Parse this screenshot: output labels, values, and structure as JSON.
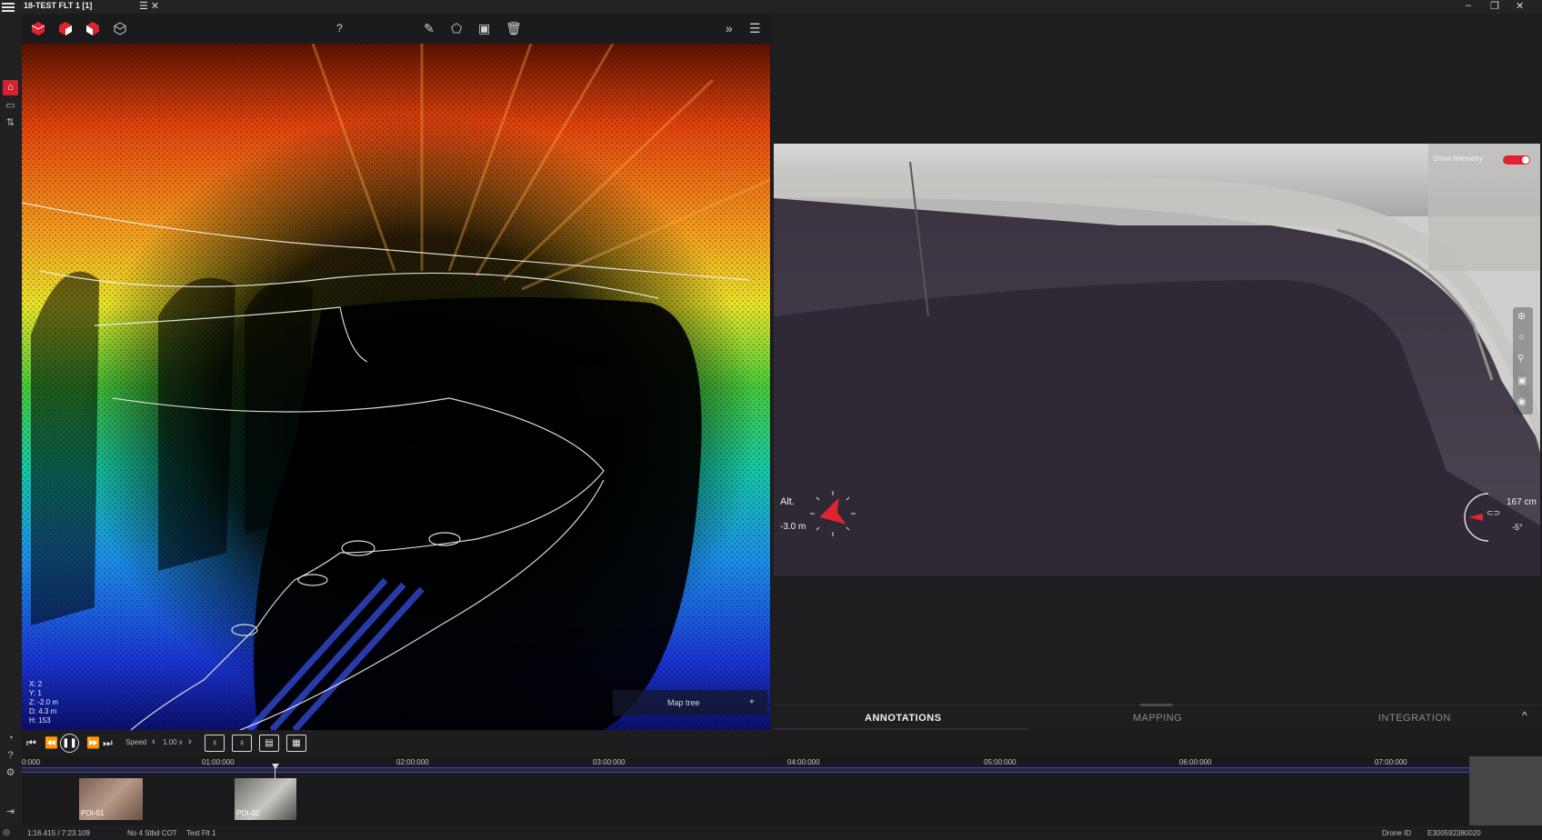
{
  "window": {
    "title": "18-TEST FLT 1 [1]",
    "minimize": "–",
    "restore": "❐",
    "close": "✕"
  },
  "toolbar3d": {
    "help": "?",
    "icons": [
      "cube-solid-icon",
      "cube-right-face-icon",
      "cube-left-face-icon",
      "cube-outline-icon",
      "pencil-icon",
      "polygon-icon",
      "save-icon",
      "trash-icon",
      "double-chevron-icon",
      "hamburger-icon"
    ]
  },
  "pointcloud": {
    "coords": [
      "X: 2",
      "Y: 1",
      "Z: -2.0 m",
      "D: 4.3 m",
      "H: 153"
    ],
    "map_tree_label": "Map tree",
    "map_tree_toggle": "+"
  },
  "playback": {
    "speed_label": "Speed",
    "speed_value": "1.00 x"
  },
  "camera": {
    "show_telemetry_label": "Show telemetry",
    "alt_label": "Alt.",
    "alt_value": "-3.0 m",
    "distance_value": "167 cm",
    "angle_value": "-5°",
    "accent_color": "#e0242f"
  },
  "tabs": {
    "annotations": "ANNOTATIONS",
    "mapping": "MAPPING",
    "integration": "INTEGRATION",
    "collapse": "^"
  },
  "timeline": {
    "ticks": [
      "0:000",
      "01:00:000",
      "02:00:000",
      "03:00:000",
      "04:00:000",
      "05:00:000",
      "06:00:000",
      "07:00:000"
    ],
    "pois": [
      "POI-01",
      "POI-02"
    ],
    "accent_color": "#3b46c8"
  },
  "status": {
    "position": "1:16.415 / 7:23.109",
    "location": "No 4 Stbd COT",
    "flight": "Test Flt 1",
    "drone_id_label": "Drone ID",
    "drone_id_value": "E300592380020"
  }
}
